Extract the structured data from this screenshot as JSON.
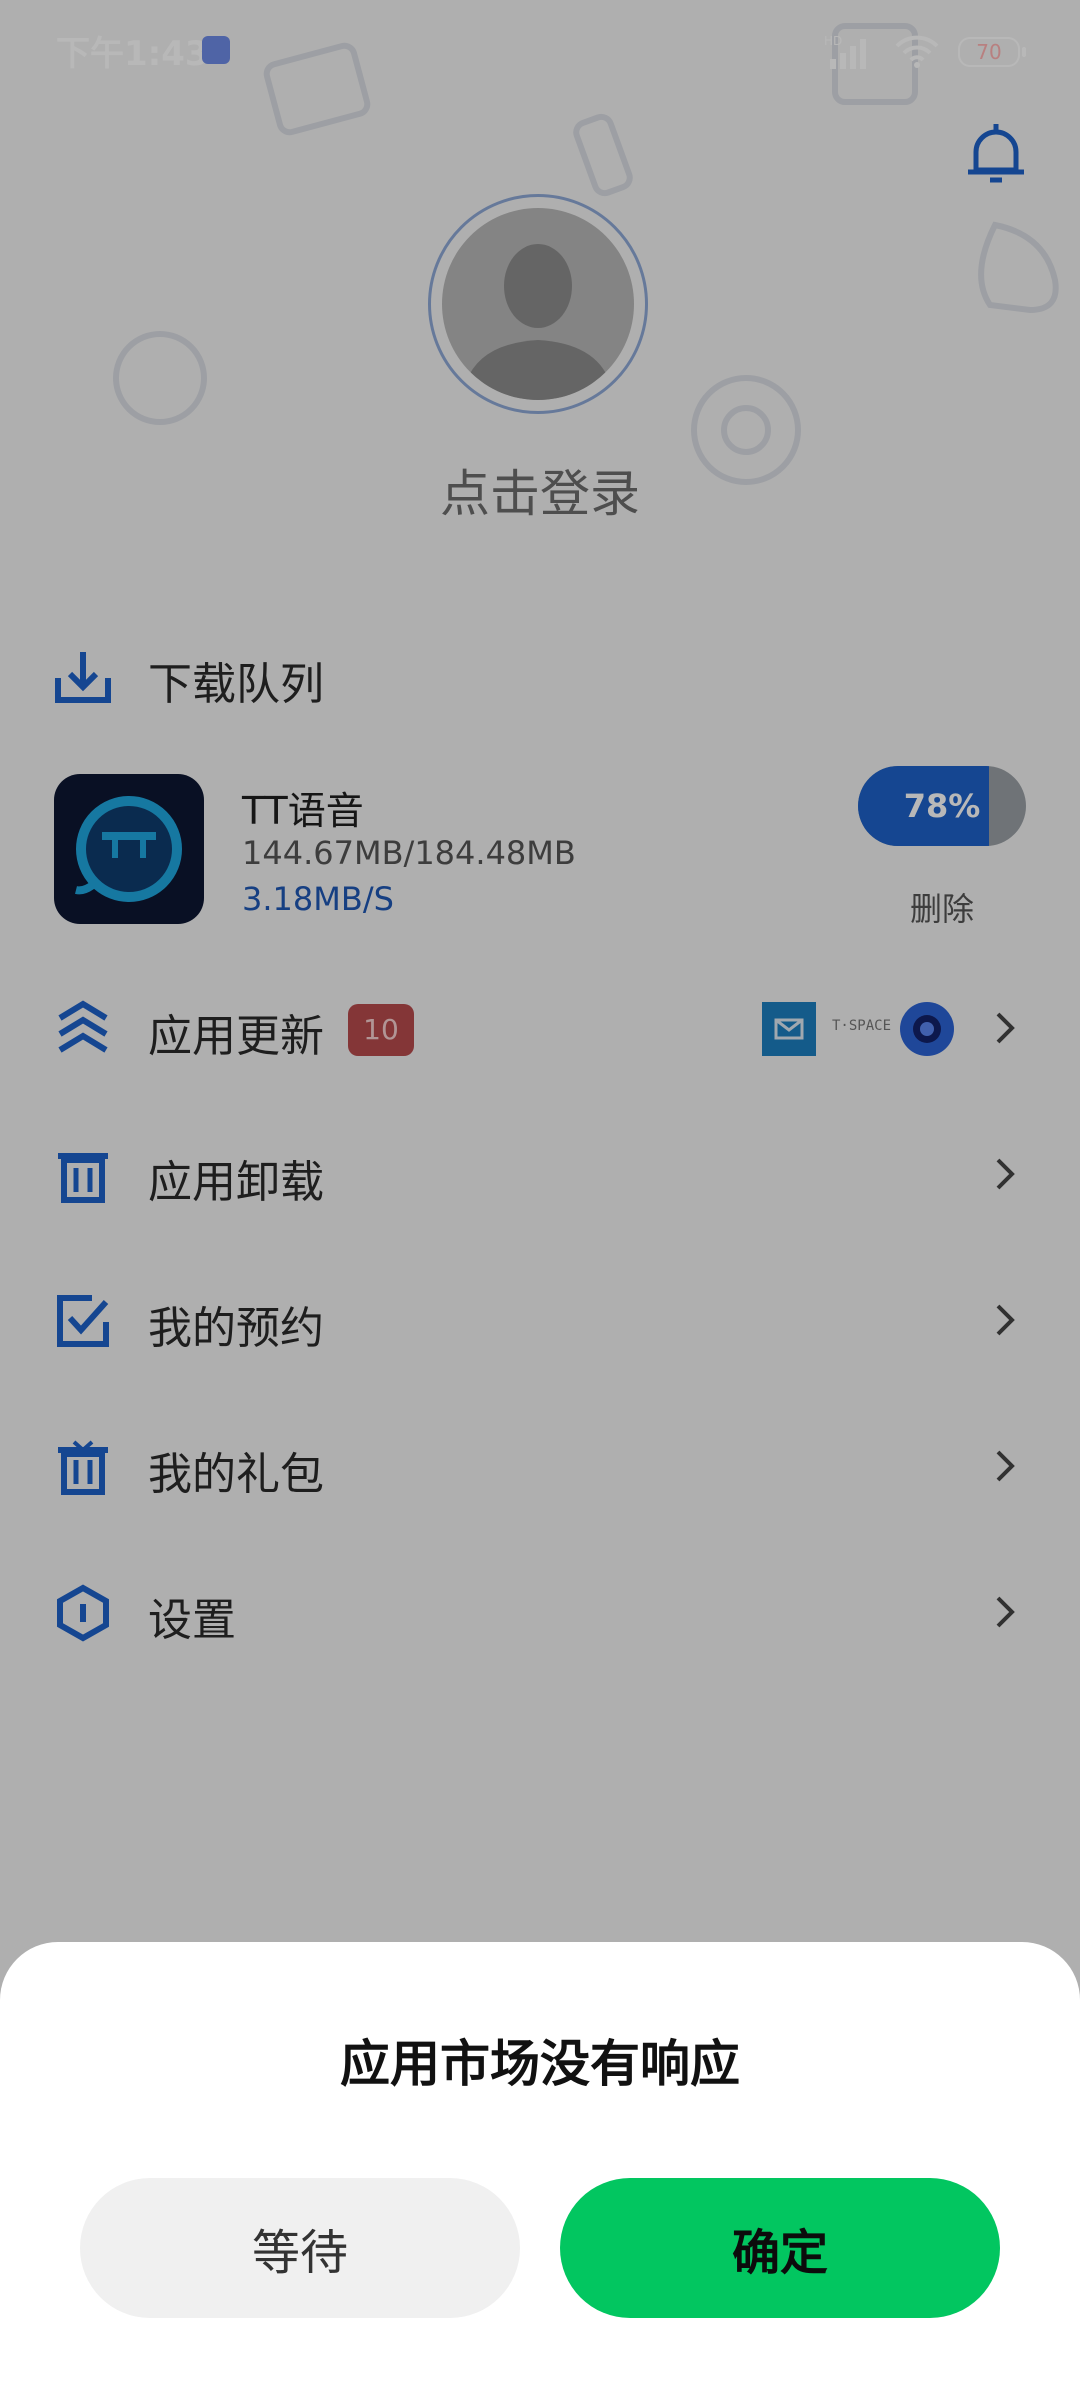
{
  "status_bar": {
    "time": "下午1:43",
    "battery": "70"
  },
  "profile": {
    "login_text": "点击登录"
  },
  "download_queue": {
    "label": "下载队列",
    "item": {
      "name": "TT语音",
      "size": "144.67MB/184.48MB",
      "speed": "3.18MB/S",
      "progress_text": "78%",
      "progress_fraction": 0.78,
      "delete_label": "删除"
    }
  },
  "menu": {
    "app_update": {
      "label": "应用更新",
      "badge": "10",
      "thumb_text": "T·SPACE"
    },
    "uninstall": {
      "label": "应用卸载"
    },
    "reservations": {
      "label": "我的预约"
    },
    "gifts": {
      "label": "我的礼包"
    },
    "settings": {
      "label": "设置"
    }
  },
  "dialog": {
    "title": "应用市场没有响应",
    "wait_label": "等待",
    "ok_label": "确定"
  },
  "colors": {
    "accent_blue": "#1e62c9",
    "badge_red": "#b84b4d",
    "ok_green": "#02c660"
  }
}
